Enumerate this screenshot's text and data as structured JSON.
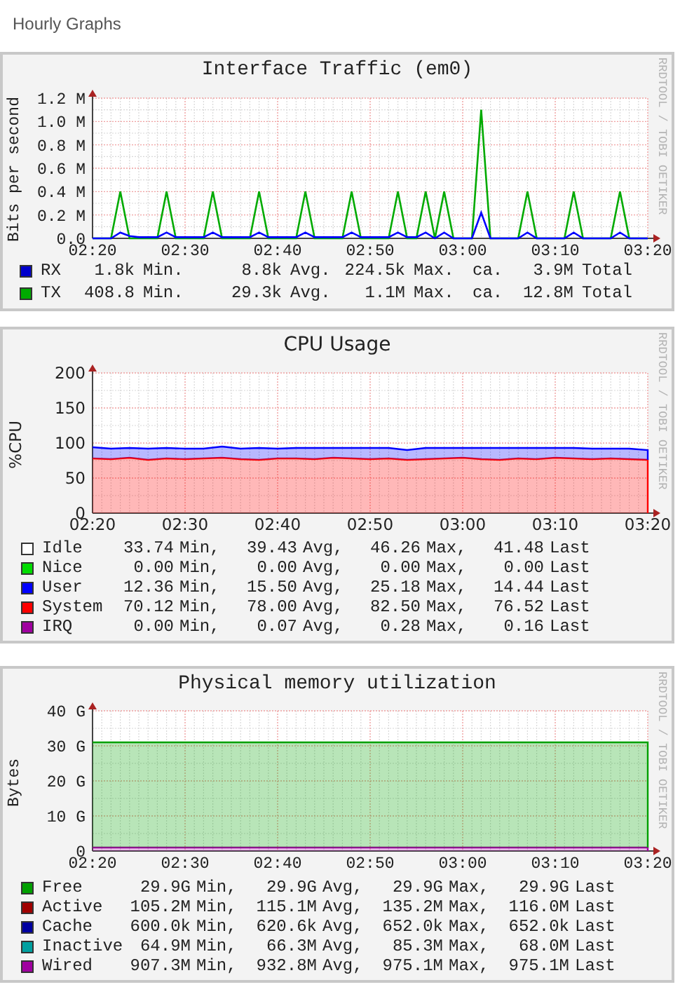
{
  "page_title": "Hourly Graphs",
  "graphs": [
    {
      "kind": "traffic",
      "credit": "RRDTOOL / TOBI OETIKER",
      "chart_data": {
        "type": "line",
        "grid": true,
        "title": "Interface Traffic (em0)",
        "ylabel": "Bits per second",
        "ylim": [
          0,
          1.2
        ],
        "categories": [
          "02:20",
          null,
          null,
          null,
          null,
          null,
          null,
          null,
          null,
          null,
          "02:30",
          null,
          null,
          null,
          null,
          null,
          null,
          null,
          null,
          null,
          "02:40",
          null,
          null,
          null,
          null,
          null,
          null,
          null,
          null,
          null,
          "02:50",
          null,
          null,
          null,
          null,
          null,
          null,
          null,
          null,
          null,
          "03:00",
          null,
          null,
          null,
          null,
          null,
          null,
          null,
          null,
          null,
          "03:10",
          null,
          null,
          null,
          null,
          null,
          null,
          null,
          null,
          null,
          "03:20"
        ],
        "yticks": [
          {
            "value": 0,
            "label": "0.0"
          },
          {
            "value": 0.2,
            "label": "0.2 M"
          },
          {
            "value": 0.4,
            "label": "0.4 M"
          },
          {
            "value": 0.6,
            "label": "0.6 M"
          },
          {
            "value": 0.8,
            "label": "0.8 M"
          },
          {
            "value": 1.0,
            "label": "1.0 M"
          },
          {
            "value": 1.2,
            "label": "1.2 M"
          }
        ],
        "series": [
          {
            "color": "#00aa00",
            "values": [
              0,
              0,
              0,
              0.4,
              0,
              0,
              0,
              0,
              0.4,
              0,
              0,
              0,
              0,
              0.4,
              0,
              0,
              0,
              0,
              0.4,
              0,
              0,
              0,
              0,
              0.4,
              0,
              0,
              0,
              0,
              0.4,
              0,
              0,
              0,
              0,
              0.4,
              0,
              0,
              0.4,
              0,
              0.4,
              0,
              0,
              0,
              1.1,
              0,
              0,
              0,
              0,
              0.4,
              0,
              0,
              0,
              0,
              0.4,
              0,
              0,
              0,
              0,
              0.4,
              0,
              0,
              0
            ]
          },
          {
            "color": "#0000ff",
            "values": [
              0,
              0,
              0,
              0.05,
              0.02,
              0.01,
              0.01,
              0.01,
              0.05,
              0.01,
              0.01,
              0.01,
              0.01,
              0.05,
              0.01,
              0.01,
              0.01,
              0.01,
              0.05,
              0.01,
              0.01,
              0.01,
              0.01,
              0.05,
              0.01,
              0.01,
              0.01,
              0.01,
              0.05,
              0.01,
              0.01,
              0.01,
              0.01,
              0.05,
              0.01,
              0.01,
              0.05,
              0,
              0.05,
              0,
              0,
              0,
              0.22,
              0,
              0,
              0,
              0,
              0.05,
              0,
              0,
              0,
              0,
              0.05,
              0,
              0,
              0,
              0,
              0.05,
              0,
              0,
              0
            ]
          }
        ]
      },
      "legend": [
        {
          "name": "RX",
          "color": "#0000cc",
          "stats": [
            {
              "value": "1.8k",
              "unit": "Min."
            },
            {
              "value": "8.8k",
              "unit": "Avg."
            },
            {
              "value": "224.5k",
              "unit": "Max."
            },
            {
              "prefix": "ca.",
              "value": "3.9M",
              "unit": "Total"
            }
          ]
        },
        {
          "name": "TX",
          "color": "#00aa00",
          "stats": [
            {
              "value": "408.8",
              "unit": "Min."
            },
            {
              "value": "29.3k",
              "unit": "Avg."
            },
            {
              "value": "1.1M",
              "unit": "Max."
            },
            {
              "prefix": "ca.",
              "value": "12.8M",
              "unit": "Total"
            }
          ]
        }
      ]
    },
    {
      "kind": "cpu",
      "credit": "RRDTOOL / TOBI OETIKER",
      "chart_data": {
        "type": "area",
        "stacked": true,
        "grid": true,
        "title": "CPU Usage",
        "ylabel": "%CPU",
        "ylim": [
          0,
          200
        ],
        "categories": [
          "02:20",
          null,
          null,
          null,
          null,
          "02:30",
          null,
          null,
          null,
          null,
          "02:40",
          null,
          null,
          null,
          null,
          "02:50",
          null,
          null,
          null,
          null,
          "03:00",
          null,
          null,
          null,
          null,
          "03:10",
          null,
          null,
          null,
          null,
          "03:20"
        ],
        "yticks": [
          0,
          50,
          100,
          150,
          200
        ],
        "series": [
          {
            "color": "#ff0000",
            "values": [
              78,
              77,
              79,
              76,
              78,
              77,
              78,
              79,
              77,
              76,
              78,
              78,
              77,
              79,
              78,
              77,
              78,
              76,
              77,
              78,
              79,
              77,
              76,
              78,
              77,
              79,
              78,
              77,
              78,
              77,
              76
            ]
          },
          {
            "color": "#0000ff",
            "values": [
              16,
              15,
              14,
              16,
              15,
              15,
              14,
              16,
              15,
              17,
              14,
              15,
              16,
              14,
              15,
              16,
              15,
              14,
              16,
              15,
              14,
              16,
              17,
              15,
              16,
              14,
              15,
              15,
              14,
              15,
              14
            ]
          }
        ]
      },
      "legend": [
        {
          "name": "Idle",
          "color": "#ffffff",
          "stats": [
            {
              "value": "33.74",
              "unit": "Min,"
            },
            {
              "value": "39.43",
              "unit": "Avg,"
            },
            {
              "value": "46.26",
              "unit": "Max,"
            },
            {
              "value": "41.48",
              "unit": "Last"
            }
          ]
        },
        {
          "name": "Nice",
          "color": "#00dd00",
          "stats": [
            {
              "value": "0.00",
              "unit": "Min,"
            },
            {
              "value": "0.00",
              "unit": "Avg,"
            },
            {
              "value": "0.00",
              "unit": "Max,"
            },
            {
              "value": "0.00",
              "unit": "Last"
            }
          ]
        },
        {
          "name": "User",
          "color": "#0000ff",
          "stats": [
            {
              "value": "12.36",
              "unit": "Min,"
            },
            {
              "value": "15.50",
              "unit": "Avg,"
            },
            {
              "value": "25.18",
              "unit": "Max,"
            },
            {
              "value": "14.44",
              "unit": "Last"
            }
          ]
        },
        {
          "name": "System",
          "color": "#ff0000",
          "stats": [
            {
              "value": "70.12",
              "unit": "Min,"
            },
            {
              "value": "78.00",
              "unit": "Avg,"
            },
            {
              "value": "82.50",
              "unit": "Max,"
            },
            {
              "value": "76.52",
              "unit": "Last"
            }
          ]
        },
        {
          "name": "IRQ",
          "color": "#a000a0",
          "stats": [
            {
              "value": "0.00",
              "unit": "Min,"
            },
            {
              "value": "0.07",
              "unit": "Avg,"
            },
            {
              "value": "0.28",
              "unit": "Max,"
            },
            {
              "value": "0.16",
              "unit": "Last"
            }
          ]
        }
      ]
    },
    {
      "kind": "memory",
      "credit": "RRDTOOL / TOBI OETIKER",
      "chart_data": {
        "type": "area",
        "stacked": true,
        "grid": true,
        "title": "Physical memory utilization",
        "ylabel": "Bytes",
        "ylim": [
          0,
          40
        ],
        "categories": [
          "02:20",
          "02:30",
          "02:40",
          "02:50",
          "03:00",
          "03:10",
          "03:20"
        ],
        "yticks": [
          {
            "value": 0,
            "label": "0"
          },
          {
            "value": 10,
            "label": "10 G"
          },
          {
            "value": 20,
            "label": "20 G"
          },
          {
            "value": 30,
            "label": "30 G"
          },
          {
            "value": 40,
            "label": "40 G"
          }
        ],
        "series": [
          {
            "color": "#a000a0",
            "values": [
              1,
              1,
              1,
              1,
              1,
              1,
              1
            ]
          },
          {
            "color": "#00a000",
            "values": [
              30,
              30,
              30,
              30,
              30,
              30,
              30
            ]
          }
        ]
      },
      "legend": [
        {
          "name": "Free",
          "color": "#00a000",
          "stats": [
            {
              "value": "29.9G",
              "unit": "Min,"
            },
            {
              "value": "29.9G",
              "unit": "Avg,"
            },
            {
              "value": "29.9G",
              "unit": "Max,"
            },
            {
              "value": "29.9G",
              "unit": "Last"
            }
          ]
        },
        {
          "name": "Active",
          "color": "#a00000",
          "stats": [
            {
              "value": "105.2M",
              "unit": "Min,"
            },
            {
              "value": "115.1M",
              "unit": "Avg,"
            },
            {
              "value": "135.2M",
              "unit": "Max,"
            },
            {
              "value": "116.0M",
              "unit": "Last"
            }
          ]
        },
        {
          "name": "Cache",
          "color": "#0000a0",
          "stats": [
            {
              "value": "600.0k",
              "unit": "Min,"
            },
            {
              "value": "620.6k",
              "unit": "Avg,"
            },
            {
              "value": "652.0k",
              "unit": "Max,"
            },
            {
              "value": "652.0k",
              "unit": "Last"
            }
          ]
        },
        {
          "name": "Inactive",
          "color": "#00a0a0",
          "stats": [
            {
              "value": "64.9M",
              "unit": "Min,"
            },
            {
              "value": "66.3M",
              "unit": "Avg,"
            },
            {
              "value": "85.3M",
              "unit": "Max,"
            },
            {
              "value": "68.0M",
              "unit": "Last"
            }
          ]
        },
        {
          "name": "Wired",
          "color": "#a000a0",
          "stats": [
            {
              "value": "907.3M",
              "unit": "Min,"
            },
            {
              "value": "932.8M",
              "unit": "Avg,"
            },
            {
              "value": "975.1M",
              "unit": "Max,"
            },
            {
              "value": "975.1M",
              "unit": "Last"
            }
          ]
        }
      ]
    }
  ]
}
